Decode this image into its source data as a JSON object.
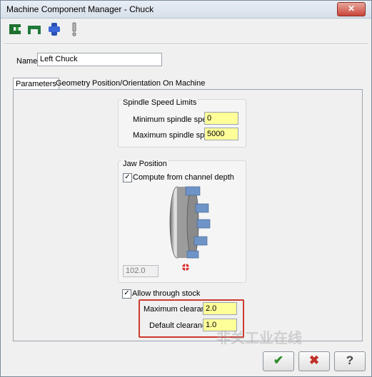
{
  "window": {
    "title": "Machine Component Manager - Chuck",
    "close_glyph": "✕"
  },
  "toolbar": {
    "icons": [
      "chuck-icon",
      "jaws-icon",
      "spindle-icon",
      "warning-icon"
    ]
  },
  "name": {
    "label": "Name:",
    "value": "Left Chuck"
  },
  "tabs": [
    {
      "label": "Parameters",
      "active": true
    },
    {
      "label": "Geometry",
      "active": false
    },
    {
      "label": "Position/Orientation On Machine",
      "active": false
    }
  ],
  "spindle": {
    "title": "Spindle Speed Limits",
    "min_label": "Minimum spindle speed:",
    "min_value": "0",
    "max_label": "Maximum spindle speed:",
    "max_value": "5000"
  },
  "jaw": {
    "title": "Jaw Position",
    "compute_label": "Compute from channel depth",
    "compute_checked": true,
    "depth_value": "102.0"
  },
  "through_stock": {
    "label": "Allow through stock",
    "checked": true
  },
  "clearance": {
    "max_label": "Maximum clearance:",
    "max_value": "2.0",
    "default_label": "Default clearance:",
    "default_value": "1.0"
  },
  "buttons": {
    "ok_glyph": "✔",
    "cancel_glyph": "✖",
    "help_glyph": "?"
  },
  "watermark": "非关工业在线",
  "colors": {
    "input_highlight": "#ffff99",
    "callout": "#cc3a2f",
    "ok": "#2e8b2e",
    "cancel": "#c0302a"
  }
}
